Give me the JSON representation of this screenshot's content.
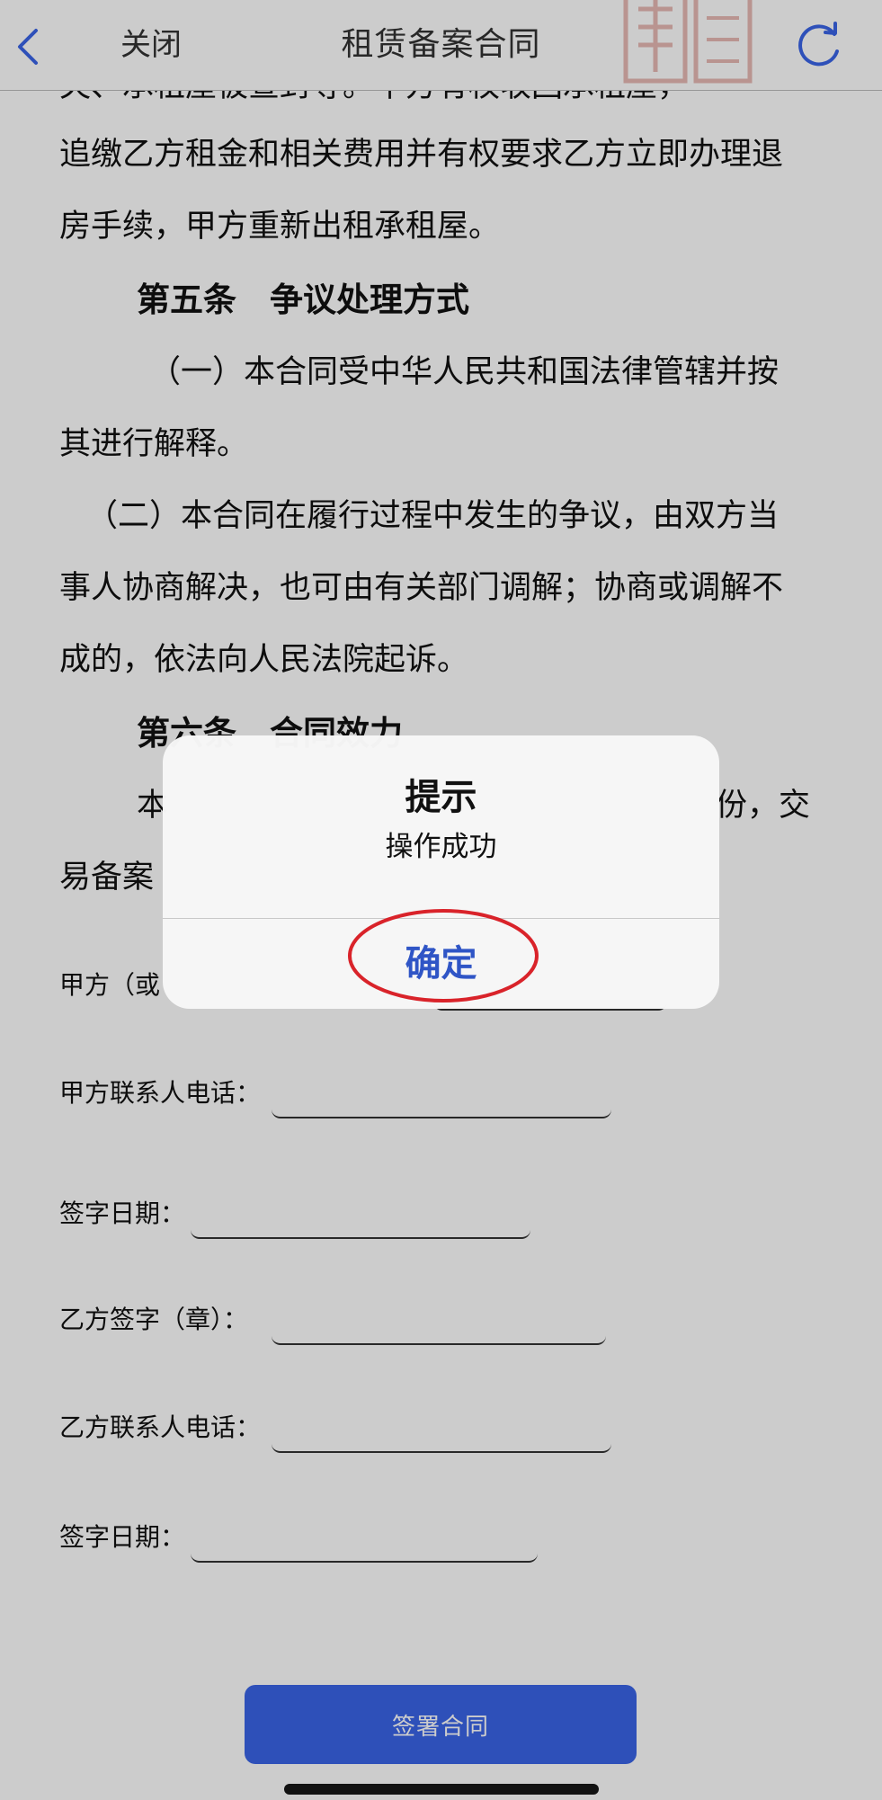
{
  "nav": {
    "back_icon": "chevron-left-icon",
    "close_label": "关闭",
    "title": "租赁备案合同",
    "refresh_icon": "refresh-icon"
  },
  "document": {
    "partial_top_line": "失、承租屋被查封等。甲方有权收回承租屋，",
    "paragraphs": [
      "追缴乙方租金和相关费用并有权要求乙方立即办理退",
      "房手续，甲方重新出租承租屋。"
    ],
    "article5_heading": "第五条　争议处理方式",
    "article5_p1_line1": "（一）本合同受中华人民共和国法律管辖并按",
    "article5_p1_line2": "其进行解释。",
    "article5_p2_line1": "（二）本合同在履行过程中发生的争议，由双方当",
    "article5_p2_line2": "事人协商解决，也可由有关部门调解；协商或调解不",
    "article5_p2_line3": "成的，依法向人民法院起诉。",
    "article6_heading": "第六条　合同效力",
    "article6_line1_start": "本",
    "article6_line1_end": "份，交",
    "article6_line2_start": "易备案"
  },
  "form": {
    "party_a_sign_label": "甲方（或",
    "party_a_phone_label": "甲方联系人电话：",
    "party_a_date_label": "签字日期：",
    "party_b_sign_label": "乙方签字（章）：",
    "party_b_phone_label": "乙方联系人电话：",
    "party_b_date_label": "签字日期：",
    "party_a_phone_value": "",
    "party_a_date_value": "",
    "party_b_sign_value": "",
    "party_b_phone_value": "",
    "party_b_date_value": ""
  },
  "sign_button_label": "签署合同",
  "alert": {
    "title": "提示",
    "message": "操作成功",
    "ok_label": "确定"
  },
  "colors": {
    "accent": "#3a65e8",
    "alert_ok": "#2f55c6",
    "annotation": "#d9232a"
  }
}
